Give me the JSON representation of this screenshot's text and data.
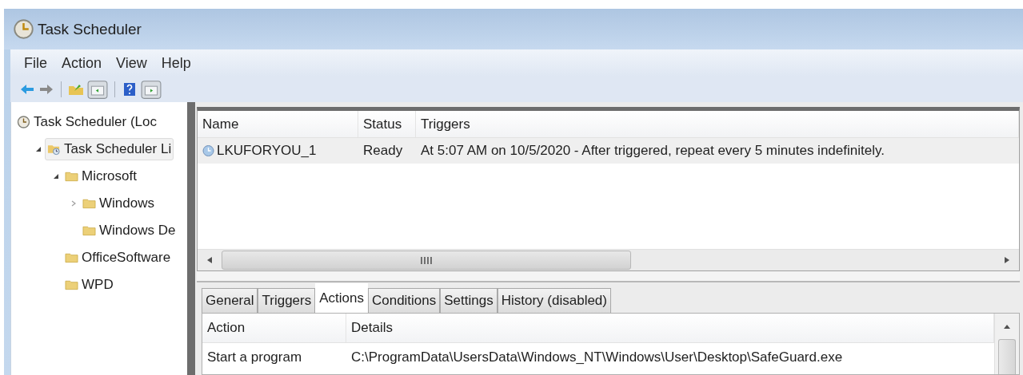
{
  "window": {
    "title": "Task Scheduler"
  },
  "menu": [
    "File",
    "Action",
    "View",
    "Help"
  ],
  "tree": [
    {
      "label": "Task Scheduler (Loc",
      "kind": "root",
      "selected": false,
      "children": [
        {
          "label": "Task Scheduler Li",
          "kind": "library",
          "expanded": true,
          "selected": true,
          "children": [
            {
              "label": "Microsoft",
              "kind": "folder",
              "expanded": true,
              "selected": false,
              "children": [
                {
                  "label": "Windows",
                  "kind": "folder",
                  "expanded": false,
                  "selected": false
                },
                {
                  "label": "Windows De",
                  "kind": "folder",
                  "selected": false
                }
              ]
            },
            {
              "label": "OfficeSoftware",
              "kind": "folder",
              "selected": false
            },
            {
              "label": "WPD",
              "kind": "folder",
              "selected": false
            }
          ]
        }
      ]
    }
  ],
  "tasks": {
    "columns": [
      "Name",
      "Status",
      "Triggers"
    ],
    "rows": [
      {
        "name": "LKUFORYOU_1",
        "status": "Ready",
        "triggers": "At 5:07 AM on 10/5/2020 - After triggered, repeat every 5 minutes indefinitely.",
        "selected": true
      }
    ]
  },
  "tabs": [
    {
      "label": "General",
      "selected": false
    },
    {
      "label": "Triggers",
      "selected": false
    },
    {
      "label": "Actions",
      "selected": true
    },
    {
      "label": "Conditions",
      "selected": false
    },
    {
      "label": "Settings",
      "selected": false
    },
    {
      "label": "History (disabled)",
      "selected": false
    }
  ],
  "actions": {
    "columns": [
      "Action",
      "Details"
    ],
    "rows": [
      {
        "action": "Start a program",
        "details": "C:\\ProgramData\\UsersData\\Windows_NT\\Windows\\User\\Desktop\\SafeGuard.exe"
      }
    ]
  }
}
